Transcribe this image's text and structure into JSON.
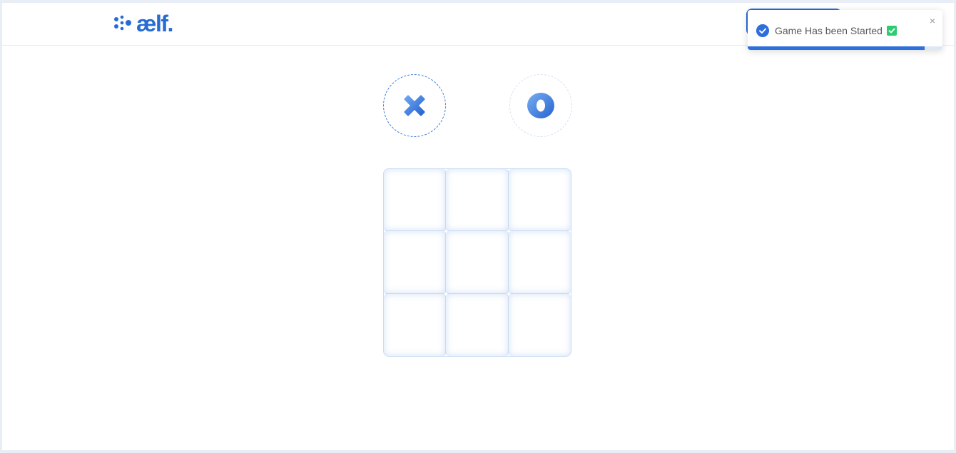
{
  "header": {
    "logo_text": "ælf."
  },
  "players": {
    "x_symbol": "X",
    "o_symbol": "O",
    "active": "X"
  },
  "board": {
    "cells": [
      "",
      "",
      "",
      "",
      "",
      "",
      "",
      "",
      ""
    ]
  },
  "toast": {
    "message": "Game Has been Started",
    "close_label": "×",
    "progress_fraction": 0.91
  },
  "colors": {
    "accent": "#266cd3",
    "board_border": "#c8dbf3",
    "success": "#2ecc71"
  },
  "icons": {
    "logo": "aelf-dots-icon",
    "player_x": "x-mark-icon",
    "player_o": "o-mark-icon",
    "toast": "check-circle-icon",
    "close": "close-icon"
  }
}
